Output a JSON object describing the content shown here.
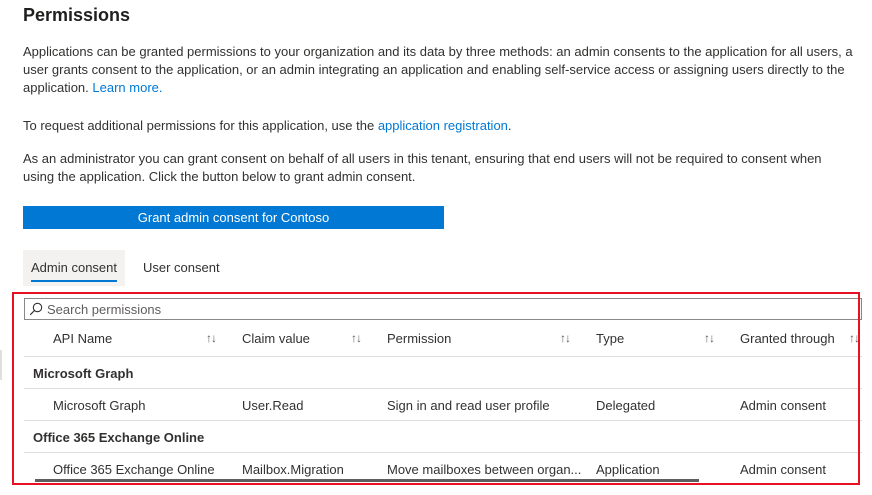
{
  "page": {
    "title": "Permissions",
    "intro_text": "Applications can be granted permissions to your organization and its data by three methods: an admin consents to the application for all users, a user grants consent to the application, or an admin integrating an application and enabling self-service access or assigning users directly to the application.",
    "learn_more": "Learn more.",
    "request_text_before": "To request additional permissions for this application, use the",
    "request_link": "application registration",
    "request_text_after": ".",
    "admin_text": "As an administrator you can grant consent on behalf of all users in this tenant, ensuring that end users will not be required to consent when using the application. Click the button below to grant admin consent.",
    "grant_button": "Grant admin consent for Contoso"
  },
  "tabs": [
    {
      "label": "Admin consent",
      "active": true
    },
    {
      "label": "User consent",
      "active": false
    }
  ],
  "search": {
    "placeholder": "Search permissions",
    "icon": "search-icon"
  },
  "table": {
    "columns": [
      "API Name",
      "Claim value",
      "Permission",
      "Type",
      "Granted through"
    ],
    "sort_glyph": "↑↓",
    "groups": [
      {
        "name": "Microsoft Graph",
        "rows": [
          {
            "api": "Microsoft Graph",
            "claim": "User.Read",
            "permission": "Sign in and read user profile",
            "type": "Delegated",
            "granted": "Admin consent"
          }
        ]
      },
      {
        "name": "Office 365 Exchange Online",
        "rows": [
          {
            "api": "Office 365 Exchange Online",
            "claim": "Mailbox.Migration",
            "permission": "Move mailboxes between organ...",
            "type": "Application",
            "granted": "Admin consent"
          }
        ]
      }
    ]
  },
  "colors": {
    "accent": "#0078d4",
    "highlight_border": "#e81123"
  }
}
